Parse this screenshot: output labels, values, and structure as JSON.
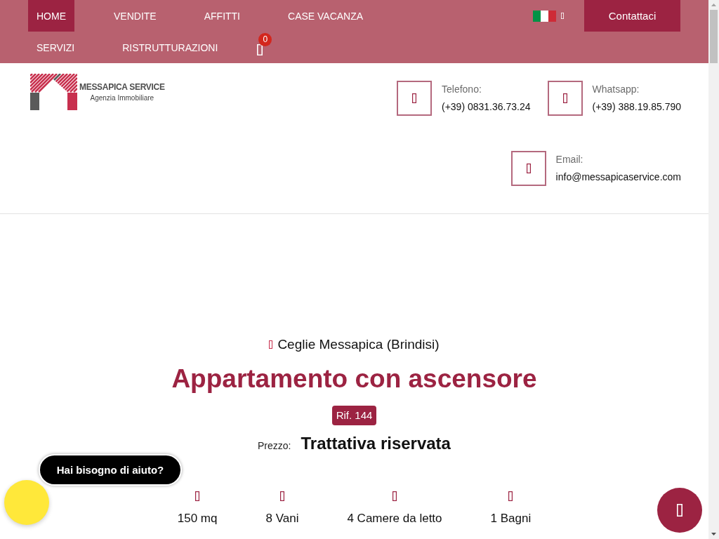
{
  "nav": {
    "menu_rows": [
      {
        "items": [
          {
            "label": "HOME",
            "selected": true
          },
          {
            "label": "VENDITE",
            "selected": false
          },
          {
            "label": "AFFITTI",
            "selected": false
          },
          {
            "label": "CASE VACANZA",
            "selected": false
          }
        ]
      },
      {
        "items": [
          {
            "label": "SERVIZI",
            "selected": false
          },
          {
            "label": "RISTRUTTURAZIONI",
            "selected": false
          }
        ]
      }
    ],
    "contact_button": "Contattaci",
    "cart": {
      "count": "0"
    }
  },
  "header": {
    "logo": {
      "name": "MESSAPICA SERVICE",
      "tagline": "Agenzia Immobiliare"
    },
    "contacts": [
      {
        "label": "Telefono:",
        "value": "(+39) 0831.36.73.24"
      },
      {
        "label": "Whatsapp:",
        "value": "(+39) 388.19.85.790"
      },
      {
        "label": "Email:",
        "value": "info@messapicaservice.com"
      }
    ]
  },
  "listing": {
    "location": "Ceglie Messapica (Brindisi)",
    "title": "Appartamento con ascensore",
    "reference": "Rif. 144",
    "price_label": "Prezzo:",
    "price": "Trattativa riservata",
    "features": [
      "150 mq",
      "8 Vani",
      "4 Camere da letto",
      "1 Bagni"
    ]
  },
  "chat_widget": {
    "prompt": "Hai bisogno di aiuto?"
  }
}
